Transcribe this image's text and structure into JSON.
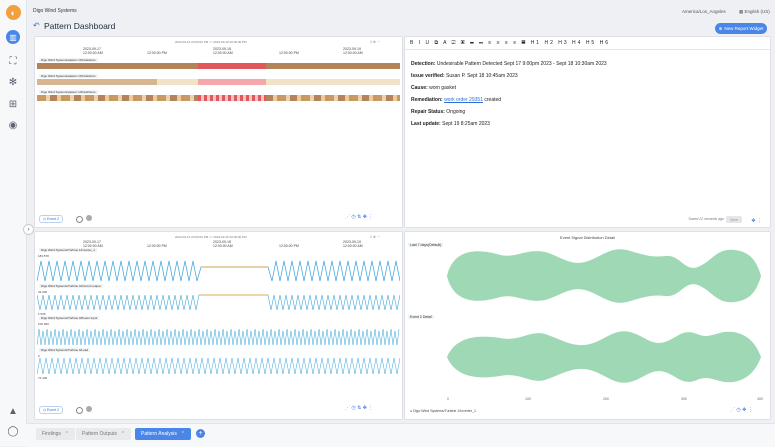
{
  "header": {
    "org": "Digo Wind Systems",
    "title": "Pattern Dashboard",
    "timezone": "America/Los_Angeles",
    "language": "English (US)",
    "new_report": "New Report Widget"
  },
  "panel1": {
    "range": "2023-09-16 20:00:00 PM <> 2023-09-19 20:00:00 PM",
    "ticks": [
      "2023-09-17\n12:00:00 AM",
      "12:00:00 PM",
      "2023-09-18\n12:00:00 AM",
      "12:00:00 PM",
      "2023-09-19\n12:00:00 AM"
    ],
    "series": [
      "Digo Wind Systems/pattern 1/Predictions",
      "Digo Wind Systems/pattern 1/Predictions",
      "Digo Wind Systems/pattern 1/Predictions"
    ],
    "event_label": "Event 2"
  },
  "panel2": {
    "toolbar": "B I U ⧉ A ☑ ▣ ☰ ☷ ≡ ≡ ≡ ≡ ▦ H1 H2 H3 H4 H5 H6",
    "detection_label": "Detection:",
    "detection_text": "Undesirable Pattern Detected Sept 17 9:00pm 2023 - Sept 18 10:30am 2023",
    "verified_label": "Issue verified:",
    "verified_text": "Susan P. Sept 18 10:45am 2023",
    "cause_label": "Cause:",
    "cause_text": "worn gasket",
    "remediation_label": "Remediation:",
    "remediation_link": "work order 29351",
    "remediation_text": "created",
    "repair_label": "Repair Status:",
    "repair_text": "Ongoing",
    "update_label": "Last update:",
    "update_text": "Sept 19 8:25am 2023",
    "saved": "Saved 22 seconds ago",
    "save_button": "Save"
  },
  "panel3": {
    "range": "2023-09-16 20:00:00 PM <> 2023-09-19 20:00:00 PM",
    "ticks": [
      "2023-09-17\n12:00:00 AM",
      "12:00:00 PM",
      "2023-09-18\n12:00:00 AM",
      "12:00:00 PM",
      "2023-09-19\n12:00:00 AM"
    ],
    "series": [
      "Digo Wind Systems/Turbine 1/Inverter_1",
      "Digo Wind Systems/Turbine 4/Current output",
      "Digo Wind Systems/Turbine 4/Power input",
      "Digo Wind Systems/Turbine 4/Load"
    ],
    "values": [
      "183.578",
      "32.000",
      "1.535",
      "100.000",
      "0",
      "72.400"
    ],
    "event_label": "Event 2"
  },
  "panel4": {
    "title": "Event Signal Distribution Detail",
    "group1": "Last 7 days(Default)",
    "group2": "Event 2 Detail",
    "xticks": [
      "0",
      "100",
      "200",
      "300",
      "400"
    ],
    "footer": "Digo Wind Systems/Turbine 1/Inverter_1"
  },
  "tabs": [
    {
      "label": "Findings",
      "active": false
    },
    {
      "label": "Pattern Outputs",
      "active": false
    },
    {
      "label": "Pattern Analysis",
      "active": true
    }
  ],
  "colors": {
    "accent": "#4a86e8",
    "violin": "#9fd8b4",
    "bar_brown": "#b5835a",
    "bar_red": "#e0585c",
    "line": "#3aa3d9"
  }
}
